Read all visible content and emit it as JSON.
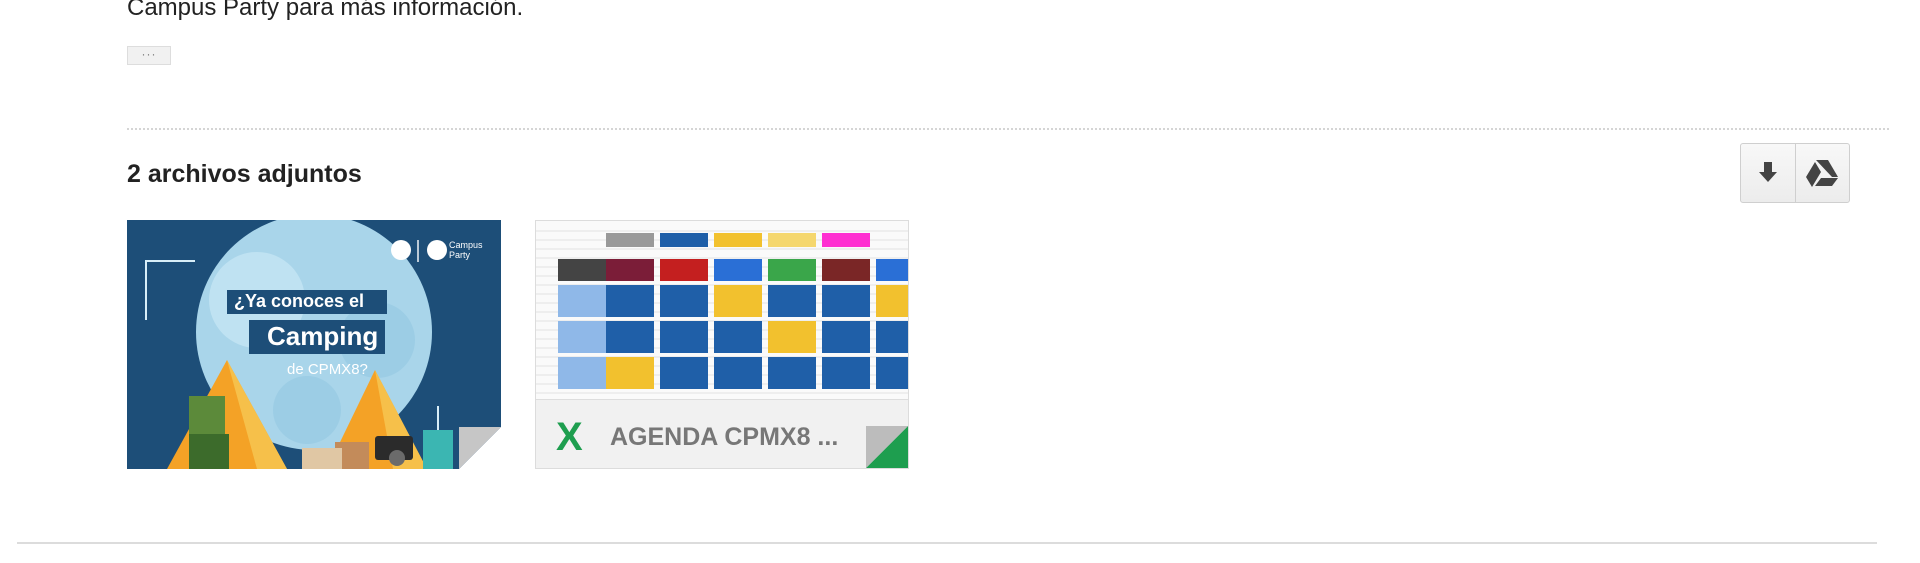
{
  "message": {
    "body_text": "Campus Party para más información.",
    "trimmed_content_label": "···"
  },
  "attachments": {
    "title": "2 archivos adjuntos",
    "actions": [
      {
        "name": "download",
        "icon": "download-icon"
      },
      {
        "name": "save-to-drive",
        "icon": "google-drive-icon"
      }
    ],
    "items": [
      {
        "kind": "image",
        "preview": {
          "logo_text": "Campus Party",
          "line1": "¿Ya conoces el",
          "line2": "Camping",
          "line3": "de CPMX8?"
        }
      },
      {
        "kind": "spreadsheet",
        "file_icon": "X",
        "file_name": "AGENDA CPMX8 ...",
        "icon_color": "#1e9e4f"
      }
    ]
  },
  "colors": {
    "poster_bg": "#1d4e78",
    "excel_green": "#1e9e4f"
  }
}
